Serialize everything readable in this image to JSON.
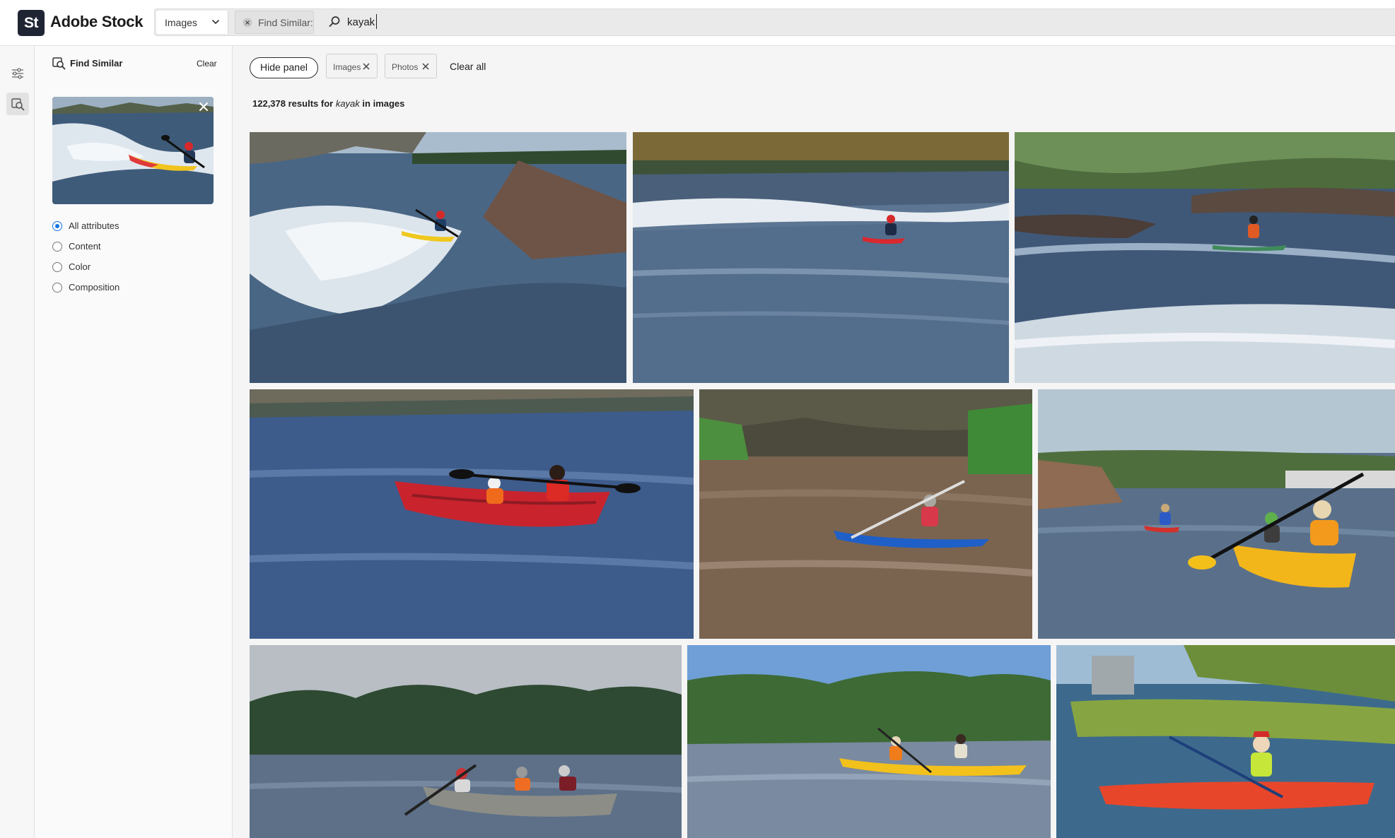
{
  "app": {
    "logo_text": "St",
    "brand": "Adobe Stock"
  },
  "search": {
    "type_selected": "Images",
    "find_similar_chip": "Find Similar:",
    "query": "kayak"
  },
  "rail": {
    "items": [
      {
        "name": "filters",
        "icon": "sliders-icon"
      },
      {
        "name": "find-similar",
        "icon": "find-similar-icon",
        "active": true
      }
    ]
  },
  "panel": {
    "title": "Find Similar",
    "clear_label": "Clear",
    "options": [
      {
        "label": "All attributes",
        "checked": true
      },
      {
        "label": "Content",
        "checked": false
      },
      {
        "label": "Color",
        "checked": false
      },
      {
        "label": "Composition",
        "checked": false
      }
    ]
  },
  "filters": {
    "hide_panel_label": "Hide panel",
    "chips": [
      "Images",
      "Photos"
    ],
    "clear_all_label": "Clear all"
  },
  "results": {
    "count": "122,378",
    "results_for": "results for",
    "query": "kayak",
    "in_label": "in images"
  },
  "colors": {
    "accent": "#1473e6",
    "logo_bg": "#1f2533"
  }
}
